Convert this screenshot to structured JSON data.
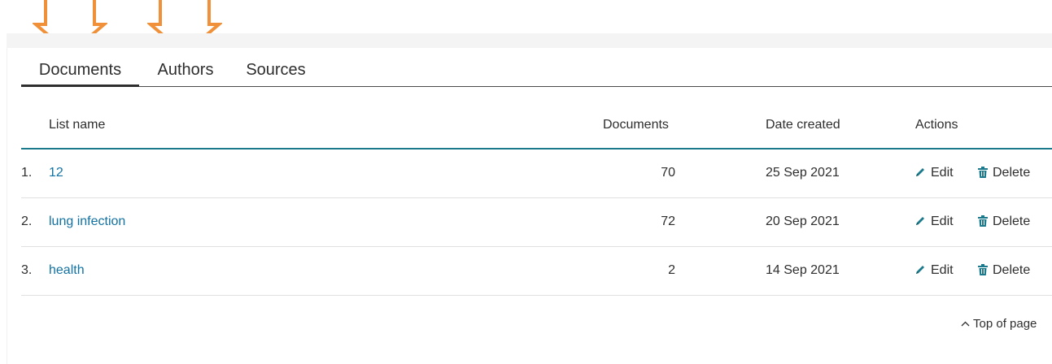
{
  "tabs": [
    {
      "label": "Documents",
      "active": true
    },
    {
      "label": "Authors",
      "active": false
    },
    {
      "label": "Sources",
      "active": false
    }
  ],
  "table": {
    "headers": {
      "name": "List name",
      "documents": "Documents",
      "date": "Date created",
      "actions": "Actions"
    },
    "rows": [
      {
        "index": "1.",
        "name": "12",
        "documents": "70",
        "date": "25 Sep 2021"
      },
      {
        "index": "2.",
        "name": "lung infection",
        "documents": "72",
        "date": "20 Sep 2021"
      },
      {
        "index": "3.",
        "name": "health",
        "documents": "2",
        "date": "14 Sep 2021"
      }
    ],
    "edit_label": "Edit",
    "delete_label": "Delete"
  },
  "footer": {
    "top_of_page": "Top of page"
  },
  "colors": {
    "accent": "#1a7a8c",
    "link": "#1272a2",
    "arrow": "#f0913a"
  },
  "icons": {
    "edit": "pencil-icon",
    "delete": "trash-icon",
    "top": "chevron-up-icon",
    "annotation": "arrow-down-annotation"
  }
}
